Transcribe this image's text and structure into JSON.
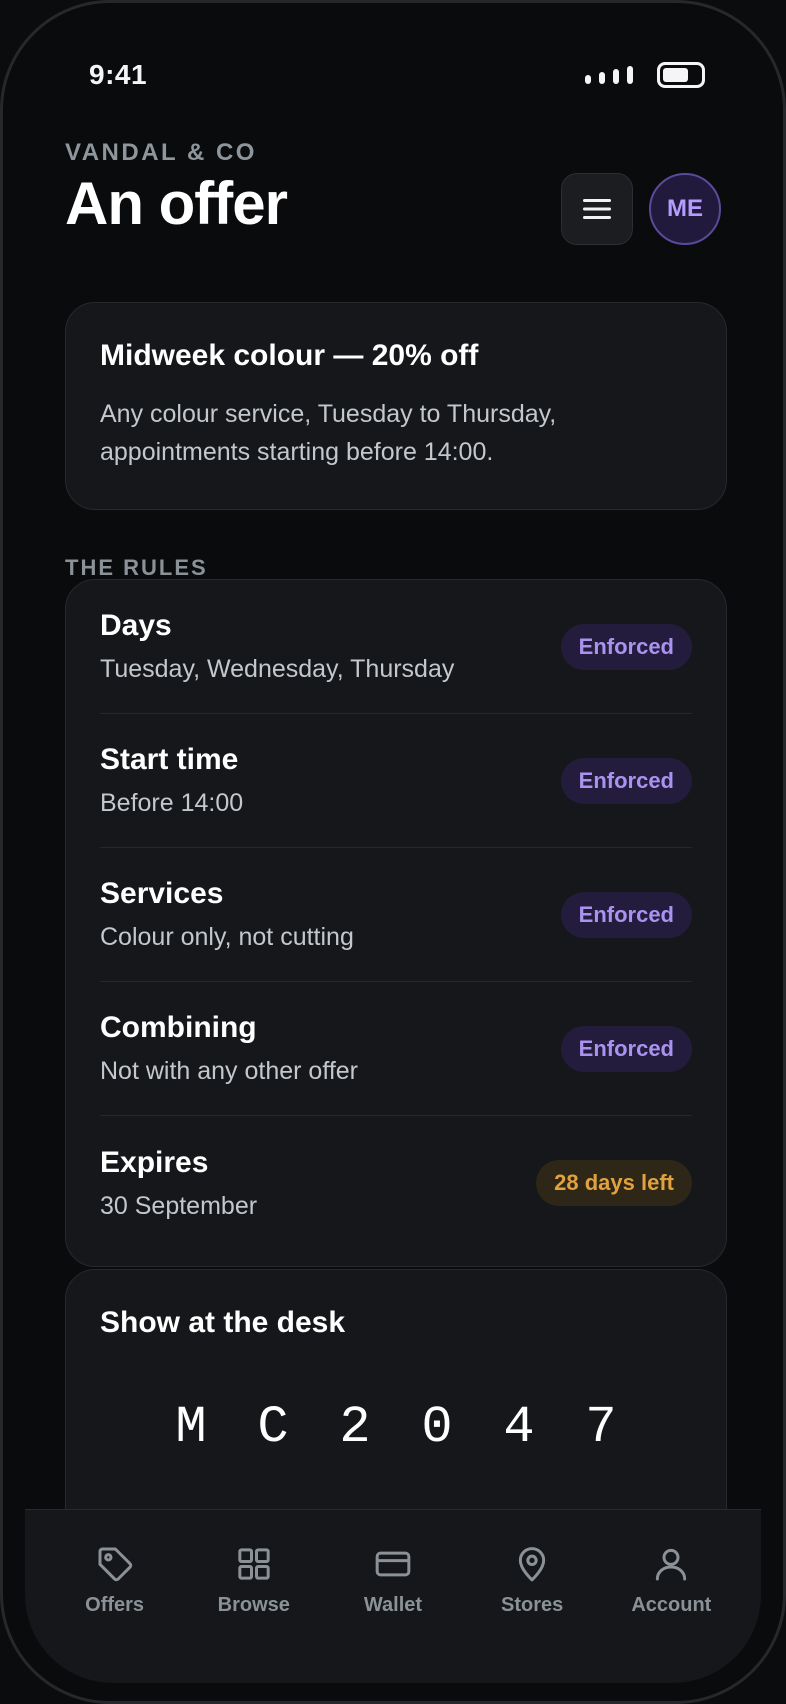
{
  "status_bar": {
    "time": "9:41"
  },
  "header": {
    "brand": "VANDAL & CO",
    "title": "An offer",
    "avatar_initials": "ME"
  },
  "offer": {
    "title": "Midweek colour — 20% off",
    "description": "Any colour service, Tuesday to Thursday, appointments starting before 14:00."
  },
  "rules_section": {
    "label": "THE RULES"
  },
  "rules": [
    {
      "name": "Days",
      "value": "Tuesday, Wednesday, Thursday",
      "badge": "Enforced"
    },
    {
      "name": "Start time",
      "value": "Before 14:00",
      "badge": "Enforced"
    },
    {
      "name": "Services",
      "value": "Colour only, not cutting",
      "badge": "Enforced"
    },
    {
      "name": "Combining",
      "value": "Not with any other offer",
      "badge": "Enforced"
    },
    {
      "name": "Expires",
      "value": "30 September",
      "badge": "28 days left"
    }
  ],
  "desk": {
    "title": "Show at the desk",
    "code": [
      "M",
      "C",
      "2",
      "0",
      "4",
      "7"
    ]
  },
  "tabs": [
    {
      "label": "Offers",
      "icon": "tag-icon"
    },
    {
      "label": "Browse",
      "icon": "grid-icon"
    },
    {
      "label": "Wallet",
      "icon": "wallet-icon"
    },
    {
      "label": "Stores",
      "icon": "location-pin-icon"
    },
    {
      "label": "Account",
      "icon": "person-icon"
    }
  ],
  "colors": {
    "accent": "#a992f0",
    "warning": "#e0a23e",
    "background": "#0a0b0d",
    "card": "#15171a"
  }
}
